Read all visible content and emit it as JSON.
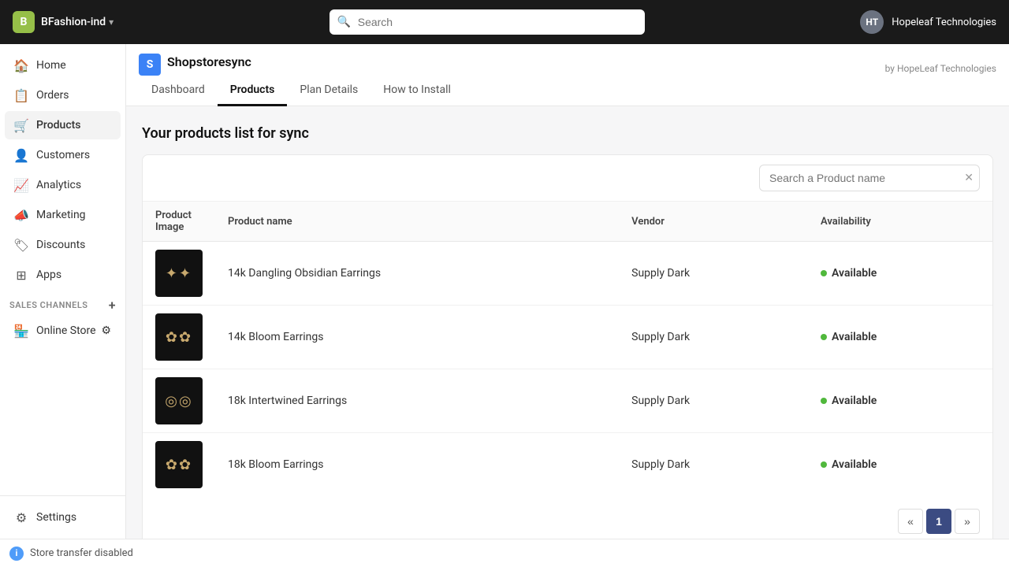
{
  "topbar": {
    "logo_text": "B",
    "store_name": "BFashion-ind",
    "search_placeholder": "Search",
    "avatar_initials": "HT",
    "company_name": "Hopeleaf Technologies"
  },
  "sidebar": {
    "items": [
      {
        "id": "home",
        "label": "Home",
        "icon": "home"
      },
      {
        "id": "orders",
        "label": "Orders",
        "icon": "orders"
      },
      {
        "id": "products",
        "label": "Products",
        "icon": "products",
        "active": true
      },
      {
        "id": "customers",
        "label": "Customers",
        "icon": "customers"
      },
      {
        "id": "analytics",
        "label": "Analytics",
        "icon": "analytics"
      },
      {
        "id": "marketing",
        "label": "Marketing",
        "icon": "marketing"
      },
      {
        "id": "discounts",
        "label": "Discounts",
        "icon": "discounts"
      },
      {
        "id": "apps",
        "label": "Apps",
        "icon": "apps"
      }
    ],
    "sales_channels_label": "SALES CHANNELS",
    "sales_channels": [
      {
        "id": "online-store",
        "label": "Online Store"
      }
    ],
    "settings_label": "Settings",
    "store_transfer_label": "Store transfer disabled"
  },
  "app": {
    "logo_text": "S",
    "title": "Shopstoresync",
    "by_label": "by HopeLeaf Technologies",
    "tabs": [
      {
        "id": "dashboard",
        "label": "Dashboard"
      },
      {
        "id": "products",
        "label": "Products",
        "active": true
      },
      {
        "id": "plan-details",
        "label": "Plan Details"
      },
      {
        "id": "how-to-install",
        "label": "How to Install"
      }
    ]
  },
  "products_page": {
    "title": "Your products list for sync",
    "search_placeholder": "Search a Product name",
    "table_headers": [
      {
        "id": "image",
        "label": "Product Image"
      },
      {
        "id": "name",
        "label": "Product name"
      },
      {
        "id": "vendor",
        "label": "Vendor"
      },
      {
        "id": "availability",
        "label": "Availability"
      }
    ],
    "products": [
      {
        "id": 1,
        "name": "14k Dangling Obsidian Earrings",
        "vendor": "Supply Dark",
        "availability": "Available"
      },
      {
        "id": 2,
        "name": "14k Bloom Earrings",
        "vendor": "Supply Dark",
        "availability": "Available"
      },
      {
        "id": 3,
        "name": "18k Intertwined Earrings",
        "vendor": "Supply Dark",
        "availability": "Available"
      },
      {
        "id": 4,
        "name": "18k Bloom Earrings",
        "vendor": "Supply Dark",
        "availability": "Available"
      }
    ],
    "pagination": {
      "prev": "«",
      "current": "1",
      "next": "»"
    }
  }
}
